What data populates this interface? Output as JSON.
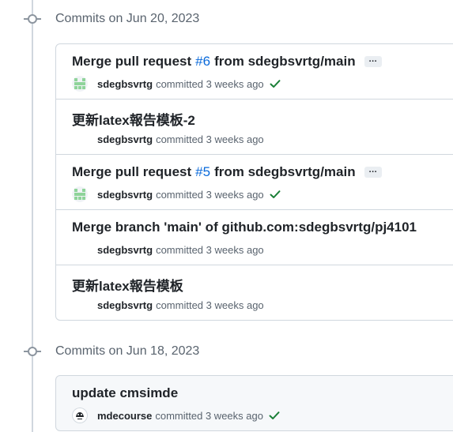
{
  "groups": [
    {
      "label": "Commits on Jun 20, 2023",
      "commits": [
        {
          "title_prefix": "Merge pull request",
          "pr": "#6",
          "title_suffix": "from sdegbsvrtg/main",
          "ellipsis": "…",
          "author": "sdegbsvrtg",
          "action": "committed",
          "time": "3 weeks ago",
          "verified": true,
          "avatar": "identicon-avatar"
        },
        {
          "title": "更新latex報告模板-2",
          "author": "sdegbsvrtg",
          "action": "committed",
          "time": "3 weeks ago",
          "verified": false
        },
        {
          "title_prefix": "Merge pull request",
          "pr": "#5",
          "title_suffix": "from sdegbsvrtg/main",
          "ellipsis": "…",
          "author": "sdegbsvrtg",
          "action": "committed",
          "time": "3 weeks ago",
          "verified": true,
          "avatar": "identicon-avatar"
        },
        {
          "title": "Merge branch 'main' of github.com:sdegbsvrtg/pj4101",
          "author": "sdegbsvrtg",
          "action": "committed",
          "time": "3 weeks ago",
          "verified": false
        },
        {
          "title": "更新latex報告模板",
          "author": "sdegbsvrtg",
          "action": "committed",
          "time": "3 weeks ago",
          "verified": false
        }
      ]
    },
    {
      "label": "Commits on Jun 18, 2023",
      "commits": [
        {
          "title": "update cmsimde",
          "author": "mdecourse",
          "action": "committed",
          "time": "3 weeks ago",
          "verified": true,
          "avatar": "logo-avatar"
        }
      ]
    }
  ],
  "colors": {
    "check": "#1a7f37",
    "link": "#0969da",
    "identicon": "#8fd49a"
  }
}
